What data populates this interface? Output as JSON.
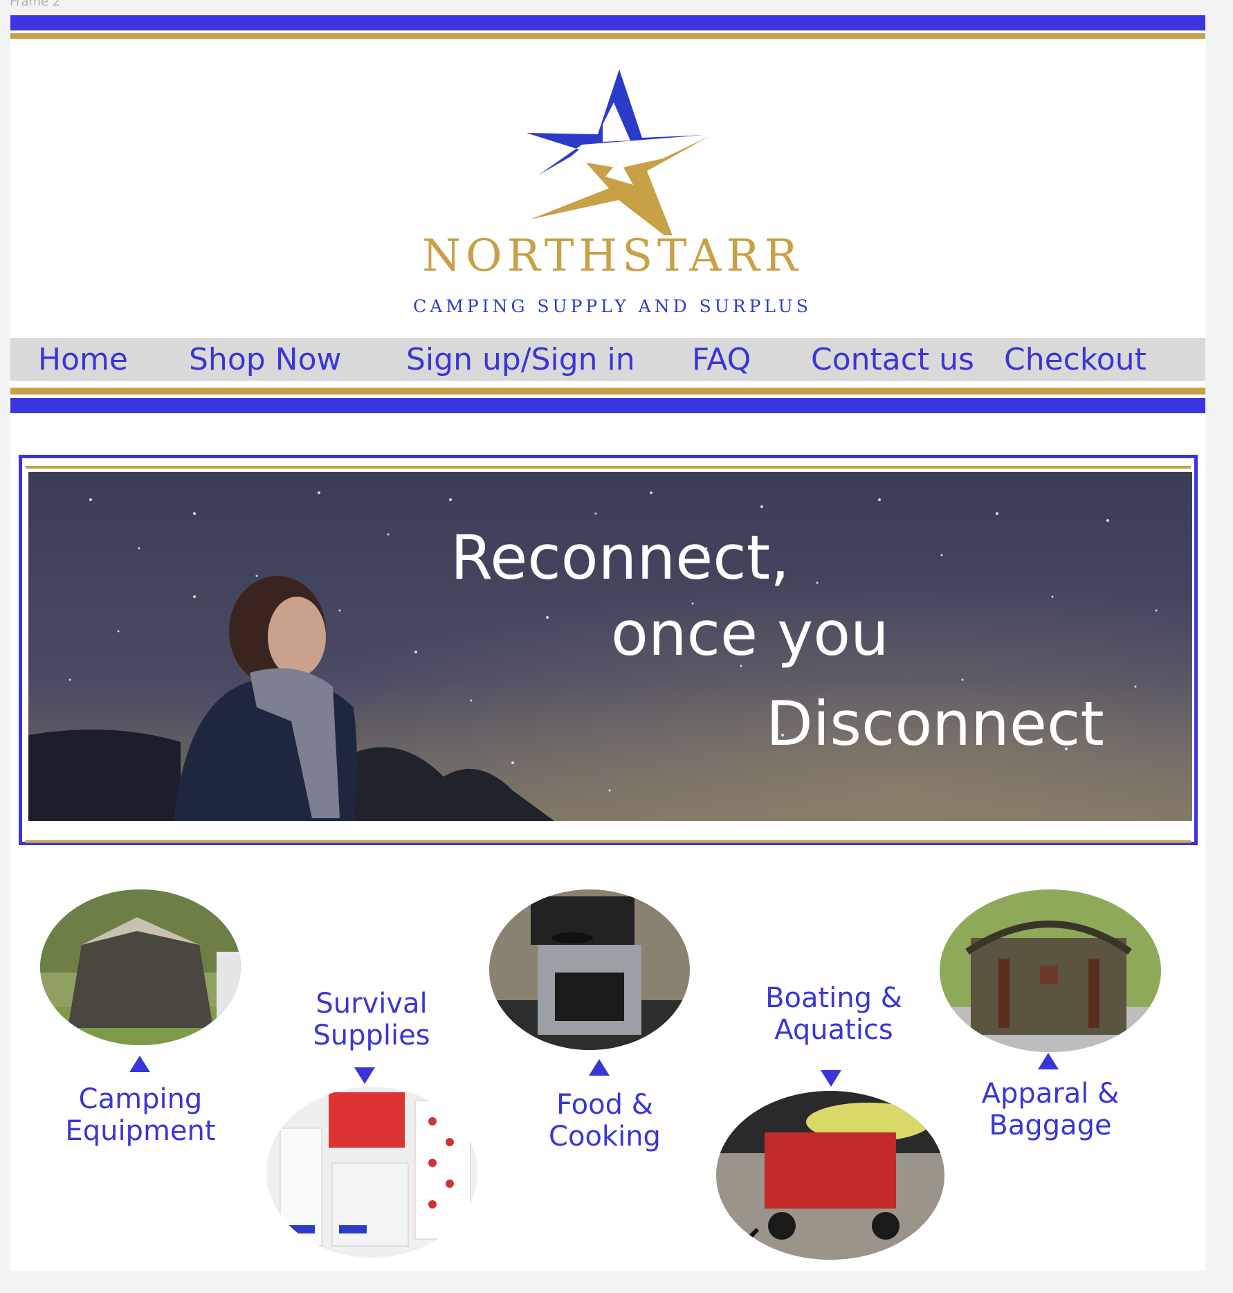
{
  "frame": {
    "label": "Frame 2"
  },
  "brand": {
    "name": "NORTHSTARR",
    "tagline": "CAMPING SUPPLY AND SURPLUS",
    "logo_icon": "star-icon",
    "colors": {
      "blue": "#2b3bc9",
      "gold": "#c8a046"
    }
  },
  "nav": {
    "items": [
      {
        "label": "Home"
      },
      {
        "label": "Shop Now"
      },
      {
        "label": "Sign up/Sign in"
      },
      {
        "label": "FAQ"
      },
      {
        "label": "Contact us"
      },
      {
        "label": "Checkout"
      }
    ]
  },
  "hero": {
    "line1": "Reconnect,",
    "line2": "once you",
    "line3": "Disconnect"
  },
  "categories": [
    {
      "label": "Camping\nEquipment",
      "arrow": "up"
    },
    {
      "label": "Survival\nSupplies",
      "arrow": "down"
    },
    {
      "label": "Food &\nCooking",
      "arrow": "up"
    },
    {
      "label": "Boating &\nAquatics",
      "arrow": "down"
    },
    {
      "label": "Apparal &\nBaggage",
      "arrow": "up"
    }
  ],
  "colors": {
    "accent_blue": "#3a35e0",
    "gold": "#c8a046",
    "nav_bg": "#d9d9d9"
  }
}
